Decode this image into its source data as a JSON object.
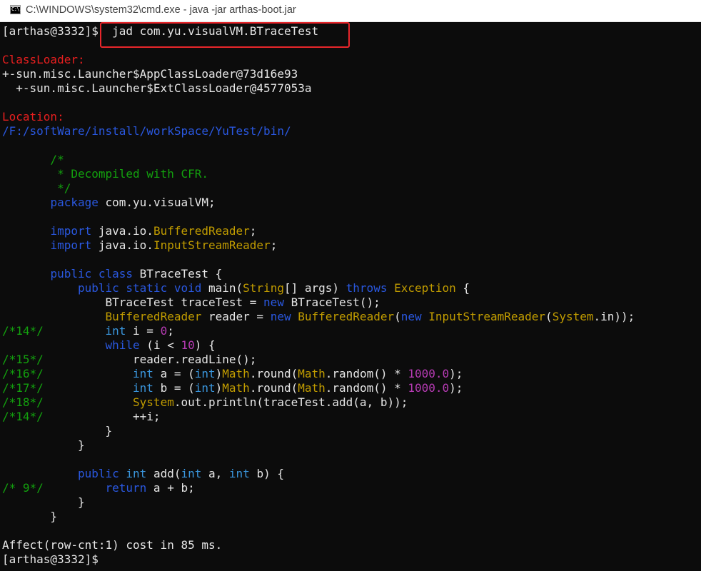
{
  "window": {
    "title": "C:\\WINDOWS\\system32\\cmd.exe - java  -jar arthas-boot.jar",
    "icon_glyph": "C:\\.",
    "icon": "cmd-icon"
  },
  "colors": {
    "background": "#0c0c0c",
    "default": "#e6e6e6",
    "red": "#e81f1f",
    "blue": "#2a58e0",
    "green": "#13a10e",
    "cyan": "#3a96dd",
    "yellow": "#c19c00",
    "magenta": "#b73bb4",
    "highlight": "#e8262b"
  },
  "console": {
    "lines": [
      {
        "segs": [
          {
            "t": "[arthas@3332]$  jad com.yu.visualVM.BTraceTest",
            "c": "default"
          }
        ]
      },
      {
        "segs": []
      },
      {
        "segs": [
          {
            "t": "ClassLoader:",
            "c": "red"
          }
        ]
      },
      {
        "segs": [
          {
            "t": "+-sun.misc.Launcher$AppClassLoader@73d16e93",
            "c": "default"
          }
        ]
      },
      {
        "segs": [
          {
            "t": "  +-sun.misc.Launcher$ExtClassLoader@4577053a",
            "c": "default"
          }
        ]
      },
      {
        "segs": []
      },
      {
        "segs": [
          {
            "t": "Location:",
            "c": "red"
          }
        ]
      },
      {
        "segs": [
          {
            "t": "/F:/softWare/install/workSpace/YuTest/bin/",
            "c": "blue"
          }
        ]
      },
      {
        "segs": []
      },
      {
        "segs": [
          {
            "t": "       /*",
            "c": "green"
          }
        ]
      },
      {
        "segs": [
          {
            "t": "        * Decompiled with CFR.",
            "c": "green"
          }
        ]
      },
      {
        "segs": [
          {
            "t": "        */",
            "c": "green"
          }
        ]
      },
      {
        "segs": [
          {
            "t": "       ",
            "c": "default"
          },
          {
            "t": "package",
            "c": "blue"
          },
          {
            "t": " com.yu.visualVM;",
            "c": "default"
          }
        ]
      },
      {
        "segs": []
      },
      {
        "segs": [
          {
            "t": "       ",
            "c": "default"
          },
          {
            "t": "import",
            "c": "blue"
          },
          {
            "t": " java.io.",
            "c": "default"
          },
          {
            "t": "BufferedReader",
            "c": "yellow"
          },
          {
            "t": ";",
            "c": "default"
          }
        ]
      },
      {
        "segs": [
          {
            "t": "       ",
            "c": "default"
          },
          {
            "t": "import",
            "c": "blue"
          },
          {
            "t": " java.io.",
            "c": "default"
          },
          {
            "t": "InputStreamReader",
            "c": "yellow"
          },
          {
            "t": ";",
            "c": "default"
          }
        ]
      },
      {
        "segs": []
      },
      {
        "segs": [
          {
            "t": "       ",
            "c": "default"
          },
          {
            "t": "public class",
            "c": "blue"
          },
          {
            "t": " BTraceTest {",
            "c": "default"
          }
        ]
      },
      {
        "segs": [
          {
            "t": "           ",
            "c": "default"
          },
          {
            "t": "public static void",
            "c": "blue"
          },
          {
            "t": " main(",
            "c": "default"
          },
          {
            "t": "String",
            "c": "yellow"
          },
          {
            "t": "[] args) ",
            "c": "default"
          },
          {
            "t": "throws",
            "c": "blue"
          },
          {
            "t": " ",
            "c": "default"
          },
          {
            "t": "Exception",
            "c": "yellow"
          },
          {
            "t": " {",
            "c": "default"
          }
        ]
      },
      {
        "segs": [
          {
            "t": "               BTraceTest traceTest = ",
            "c": "default"
          },
          {
            "t": "new",
            "c": "blue"
          },
          {
            "t": " BTraceTest();",
            "c": "default"
          }
        ]
      },
      {
        "segs": [
          {
            "t": "               ",
            "c": "default"
          },
          {
            "t": "BufferedReader",
            "c": "yellow"
          },
          {
            "t": " reader = ",
            "c": "default"
          },
          {
            "t": "new",
            "c": "blue"
          },
          {
            "t": " ",
            "c": "default"
          },
          {
            "t": "BufferedReader",
            "c": "yellow"
          },
          {
            "t": "(",
            "c": "default"
          },
          {
            "t": "new",
            "c": "blue"
          },
          {
            "t": " ",
            "c": "default"
          },
          {
            "t": "InputStreamReader",
            "c": "yellow"
          },
          {
            "t": "(",
            "c": "default"
          },
          {
            "t": "System",
            "c": "yellow"
          },
          {
            "t": ".in));",
            "c": "default"
          }
        ]
      },
      {
        "segs": [
          {
            "t": "/*14*/",
            "c": "green"
          },
          {
            "t": "         ",
            "c": "default"
          },
          {
            "t": "int",
            "c": "cyan"
          },
          {
            "t": " i = ",
            "c": "default"
          },
          {
            "t": "0",
            "c": "magenta"
          },
          {
            "t": ";",
            "c": "default"
          }
        ]
      },
      {
        "segs": [
          {
            "t": "               ",
            "c": "default"
          },
          {
            "t": "while",
            "c": "blue"
          },
          {
            "t": " (i < ",
            "c": "default"
          },
          {
            "t": "10",
            "c": "magenta"
          },
          {
            "t": ") {",
            "c": "default"
          }
        ]
      },
      {
        "segs": [
          {
            "t": "/*15*/",
            "c": "green"
          },
          {
            "t": "             reader.readLine();",
            "c": "default"
          }
        ]
      },
      {
        "segs": [
          {
            "t": "/*16*/",
            "c": "green"
          },
          {
            "t": "             ",
            "c": "default"
          },
          {
            "t": "int",
            "c": "cyan"
          },
          {
            "t": " a = (",
            "c": "default"
          },
          {
            "t": "int",
            "c": "cyan"
          },
          {
            "t": ")",
            "c": "default"
          },
          {
            "t": "Math",
            "c": "yellow"
          },
          {
            "t": ".round(",
            "c": "default"
          },
          {
            "t": "Math",
            "c": "yellow"
          },
          {
            "t": ".random() * ",
            "c": "default"
          },
          {
            "t": "1000.0",
            "c": "magenta"
          },
          {
            "t": ");",
            "c": "default"
          }
        ]
      },
      {
        "segs": [
          {
            "t": "/*17*/",
            "c": "green"
          },
          {
            "t": "             ",
            "c": "default"
          },
          {
            "t": "int",
            "c": "cyan"
          },
          {
            "t": " b = (",
            "c": "default"
          },
          {
            "t": "int",
            "c": "cyan"
          },
          {
            "t": ")",
            "c": "default"
          },
          {
            "t": "Math",
            "c": "yellow"
          },
          {
            "t": ".round(",
            "c": "default"
          },
          {
            "t": "Math",
            "c": "yellow"
          },
          {
            "t": ".random() * ",
            "c": "default"
          },
          {
            "t": "1000.0",
            "c": "magenta"
          },
          {
            "t": ");",
            "c": "default"
          }
        ]
      },
      {
        "segs": [
          {
            "t": "/*18*/",
            "c": "green"
          },
          {
            "t": "             ",
            "c": "default"
          },
          {
            "t": "System",
            "c": "yellow"
          },
          {
            "t": ".out.println(traceTest.add(a, b));",
            "c": "default"
          }
        ]
      },
      {
        "segs": [
          {
            "t": "/*14*/",
            "c": "green"
          },
          {
            "t": "             ++i;",
            "c": "default"
          }
        ]
      },
      {
        "segs": [
          {
            "t": "               }",
            "c": "default"
          }
        ]
      },
      {
        "segs": [
          {
            "t": "           }",
            "c": "default"
          }
        ]
      },
      {
        "segs": []
      },
      {
        "segs": [
          {
            "t": "           ",
            "c": "default"
          },
          {
            "t": "public",
            "c": "blue"
          },
          {
            "t": " ",
            "c": "default"
          },
          {
            "t": "int",
            "c": "cyan"
          },
          {
            "t": " add(",
            "c": "default"
          },
          {
            "t": "int",
            "c": "cyan"
          },
          {
            "t": " a, ",
            "c": "default"
          },
          {
            "t": "int",
            "c": "cyan"
          },
          {
            "t": " b) {",
            "c": "default"
          }
        ]
      },
      {
        "segs": [
          {
            "t": "/* 9*/",
            "c": "green"
          },
          {
            "t": "         ",
            "c": "default"
          },
          {
            "t": "return",
            "c": "blue"
          },
          {
            "t": " a + b;",
            "c": "default"
          }
        ]
      },
      {
        "segs": [
          {
            "t": "           }",
            "c": "default"
          }
        ]
      },
      {
        "segs": [
          {
            "t": "       }",
            "c": "default"
          }
        ]
      },
      {
        "segs": []
      },
      {
        "segs": [
          {
            "t": "Affect(row-cnt:1) cost in 85 ms.",
            "c": "default"
          }
        ]
      },
      {
        "segs": [
          {
            "t": "[arthas@3332]$",
            "c": "default"
          }
        ]
      }
    ]
  }
}
